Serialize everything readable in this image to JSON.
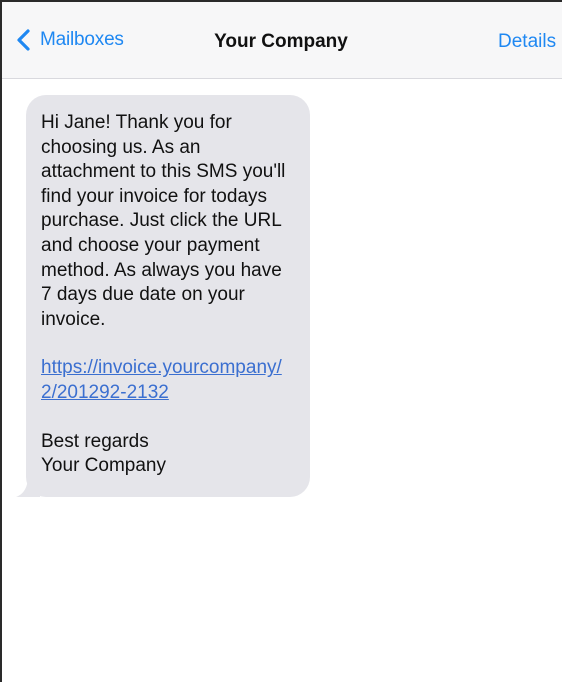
{
  "header": {
    "back_label": "Mailboxes",
    "title": "Your Company",
    "details_label": "Details"
  },
  "message": {
    "body": "Hi Jane! Thank you for choosing us. As an attachment to this SMS you'll find your invoice for todays purchase. Just click the URL and choose your payment method. As always you have 7 days due date on your invoice.",
    "link": "https://invoice.yourcompany/2/201292-2132",
    "closing_line1": "Best regards",
    "closing_line2": "Your Company"
  },
  "icons": {
    "back": "chevron-left-icon"
  },
  "colors": {
    "accent": "#1f88f2",
    "bubble": "#e5e5ea",
    "link": "#3b6fd0",
    "navbar": "#f7f7f8"
  }
}
